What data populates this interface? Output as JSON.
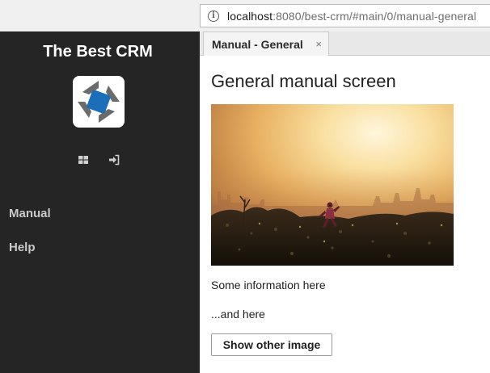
{
  "browser": {
    "url_host": "localhost",
    "url_rest": ":8080/best-crm/#main/0/manual-general"
  },
  "sidebar": {
    "brand_title": "The Best CRM",
    "tools": [
      "windows-icon",
      "login-icon"
    ],
    "items": [
      {
        "label": "Manual"
      },
      {
        "label": "Help"
      }
    ]
  },
  "tabs": [
    {
      "label": "Manual - General",
      "close": "×"
    }
  ],
  "content": {
    "heading": "General manual screen",
    "paragraph_1": "Some information here",
    "paragraph_2": "...and here",
    "button_label": "Show other image"
  },
  "colors": {
    "sidebar_bg": "#252525",
    "logo_blue": "#1a6fb8",
    "logo_gray": "#6b6b6b"
  }
}
